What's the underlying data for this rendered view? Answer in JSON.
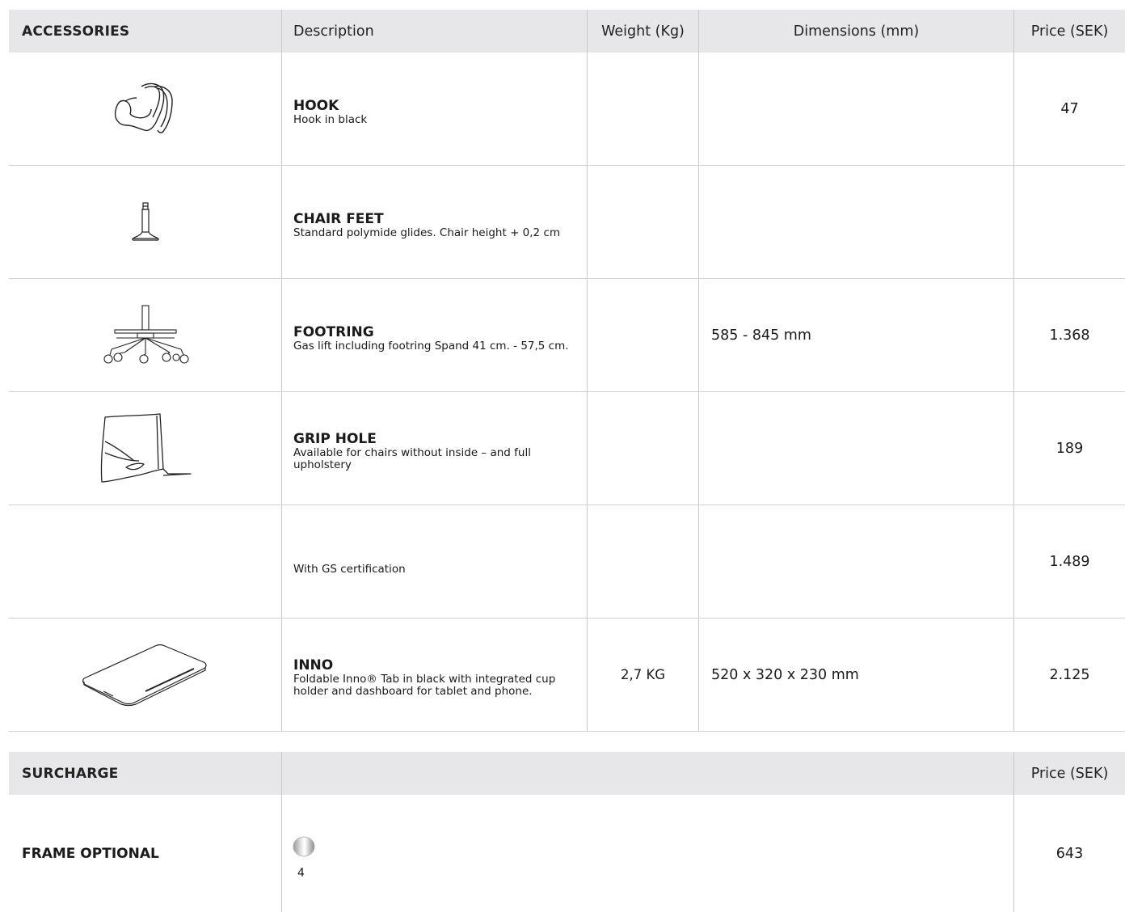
{
  "accessories": {
    "headers": {
      "accessories": "ACCESSORIES",
      "description": "Description",
      "weight": "Weight (Kg)",
      "dimensions": "Dimensions (mm)",
      "price": "Price (SEK)"
    },
    "items": [
      {
        "icon": "hook-icon",
        "name": "HOOK",
        "description": "Hook in black",
        "weight": "",
        "dimensions": "",
        "price": "47"
      },
      {
        "icon": "chair-feet-icon",
        "name": "CHAIR FEET",
        "description": "Standard polymide glides. Chair height + 0,2 cm",
        "weight": "",
        "dimensions": "",
        "price": ""
      },
      {
        "icon": "footring-icon",
        "name": "FOOTRING",
        "description": "Gas lift including footring Spand 41 cm. - 57,5 cm.",
        "weight": "",
        "dimensions": "585 - 845 mm",
        "price": "1.368"
      },
      {
        "icon": "grip-hole-icon",
        "name": "GRIP HOLE",
        "description": "Available for chairs without inside – and full upholstery",
        "weight": "",
        "dimensions": "",
        "price": "189"
      },
      {
        "icon": "",
        "name": "",
        "description": "With GS certification",
        "weight": "",
        "dimensions": "",
        "price": "1.489"
      },
      {
        "icon": "inno-tab-icon",
        "name": "INNO",
        "description": "Foldable Inno® Tab in black with integrated cup holder and dashboard for tablet and phone.",
        "weight": "2,7 KG",
        "dimensions": "520 x 320 x 230 mm",
        "price": "2.125"
      }
    ]
  },
  "surcharge": {
    "headers": {
      "surcharge": "SURCHARGE",
      "price": "Price (SEK)"
    },
    "rows": [
      {
        "label": "FRAME OPTIONAL",
        "finish_icon": "chrome-swatch-icon",
        "finish_count": "4",
        "price": "643"
      }
    ]
  },
  "colors": {
    "header_bg": "#e7e7ea",
    "border": "#cfcfcf",
    "text": "#1a1a1a"
  }
}
